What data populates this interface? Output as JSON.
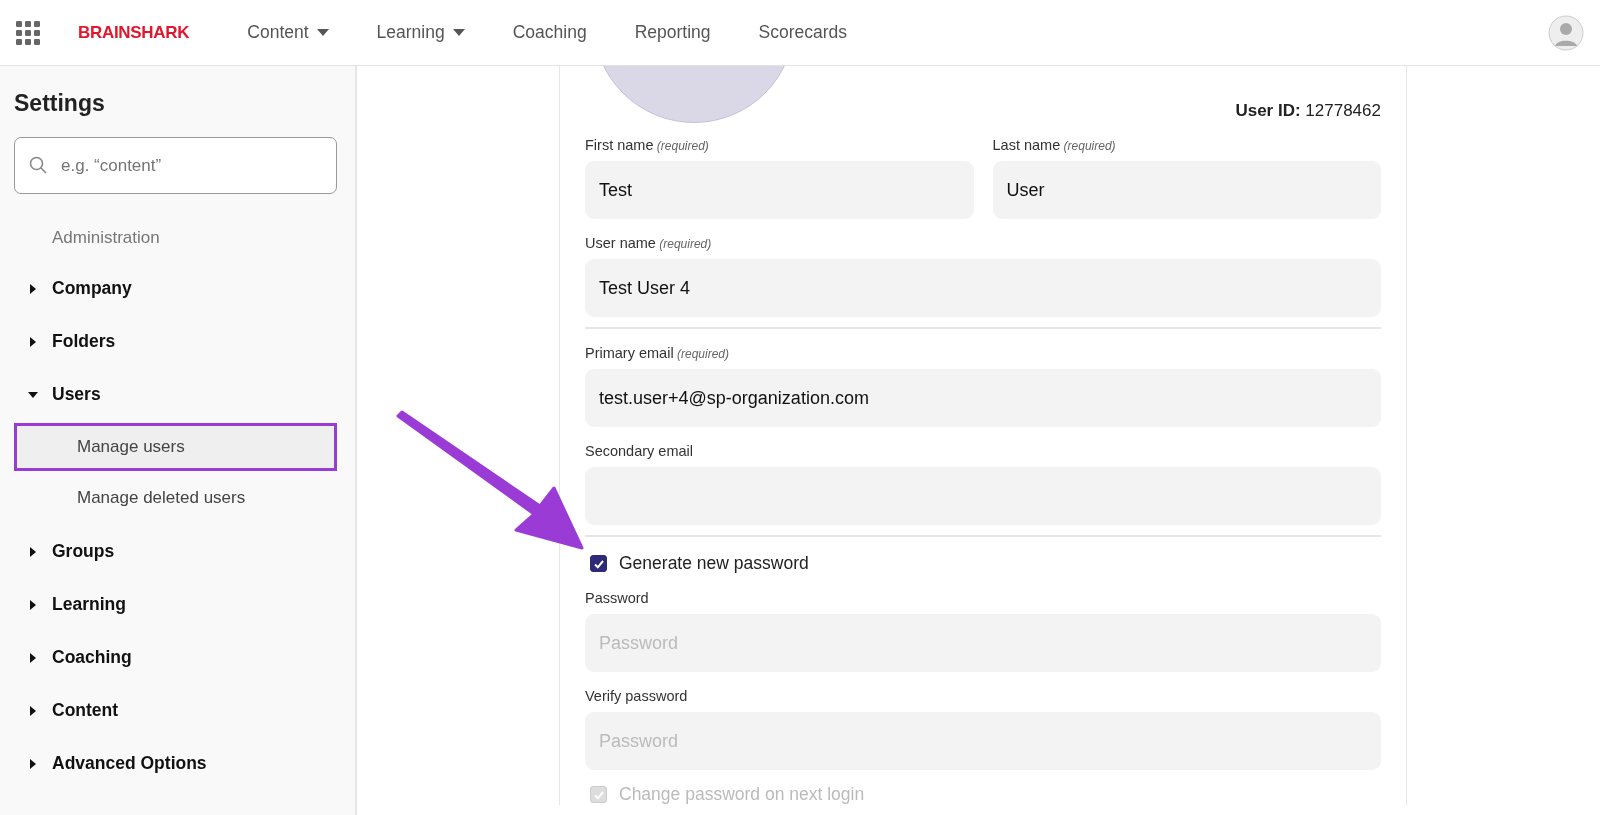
{
  "app_bar": {
    "brand": "BRAINSHARK",
    "nav": [
      {
        "label": "Content",
        "dropdown": true
      },
      {
        "label": "Learning",
        "dropdown": true
      },
      {
        "label": "Coaching",
        "dropdown": false
      },
      {
        "label": "Reporting",
        "dropdown": false
      },
      {
        "label": "Scorecards",
        "dropdown": false
      }
    ]
  },
  "sidebar": {
    "title": "Settings",
    "search": {
      "placeholder": "e.g. “content”"
    },
    "section_label": "Administration",
    "items": [
      {
        "label": "Company",
        "expanded": false
      },
      {
        "label": "Folders",
        "expanded": false
      },
      {
        "label": "Users",
        "expanded": true,
        "children": [
          {
            "label": "Manage users",
            "selected": true
          },
          {
            "label": "Manage deleted users",
            "selected": false
          }
        ]
      },
      {
        "label": "Groups",
        "expanded": false
      },
      {
        "label": "Learning",
        "expanded": false
      },
      {
        "label": "Coaching",
        "expanded": false
      },
      {
        "label": "Content",
        "expanded": false
      },
      {
        "label": "Advanced Options",
        "expanded": false
      }
    ]
  },
  "form": {
    "user_id_label": "User ID:",
    "user_id": "12778462",
    "items": [
      {
        "kind": "field_row",
        "fields": [
          {
            "label": "First name",
            "note": "(required)",
            "value": "Test"
          },
          {
            "label": "Last name",
            "note": "(required)",
            "value": "User"
          }
        ]
      },
      {
        "kind": "field_row",
        "fields": [
          {
            "label": "User name",
            "note": "(required)",
            "value": "Test User 4"
          }
        ]
      },
      {
        "kind": "divider"
      },
      {
        "kind": "field_row",
        "fields": [
          {
            "label": "Primary email",
            "note": "(required)",
            "value": "test.user+4@sp-organization.com"
          }
        ]
      },
      {
        "kind": "field_row",
        "fields": [
          {
            "label": "Secondary email"
          }
        ]
      },
      {
        "kind": "divider"
      },
      {
        "kind": "checkbox",
        "label": "Generate new password",
        "checked": true,
        "disabled": false
      },
      {
        "kind": "field_row",
        "fields": [
          {
            "label": "Password",
            "placeholder": "Password"
          }
        ]
      },
      {
        "kind": "field_row",
        "fields": [
          {
            "label": "Verify password",
            "placeholder": "Password"
          }
        ]
      },
      {
        "kind": "checkbox",
        "label": "Change password on next login",
        "checked": true,
        "disabled": true
      }
    ]
  }
}
